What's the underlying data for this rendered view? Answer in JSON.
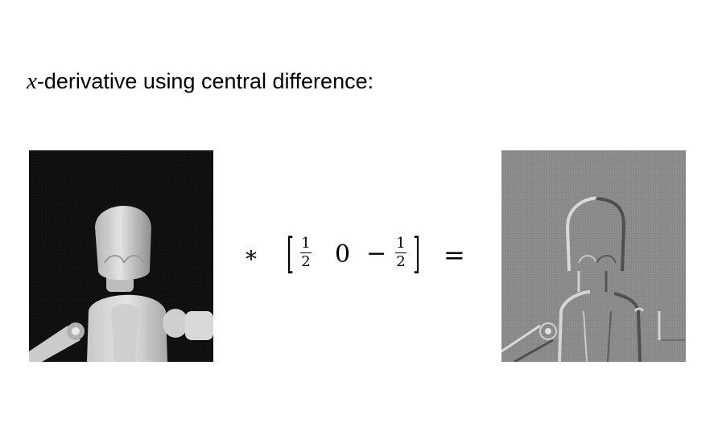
{
  "title": {
    "variable": "x",
    "text": "-derivative using central difference:"
  },
  "equation": {
    "operator": "*",
    "kernel": {
      "left_bracket": "[",
      "right_bracket": "]",
      "frac1": {
        "numerator": "1",
        "denominator": "2"
      },
      "middle": "0",
      "minus": "−",
      "frac2": {
        "numerator": "1",
        "denominator": "2"
      }
    },
    "equals": "="
  }
}
